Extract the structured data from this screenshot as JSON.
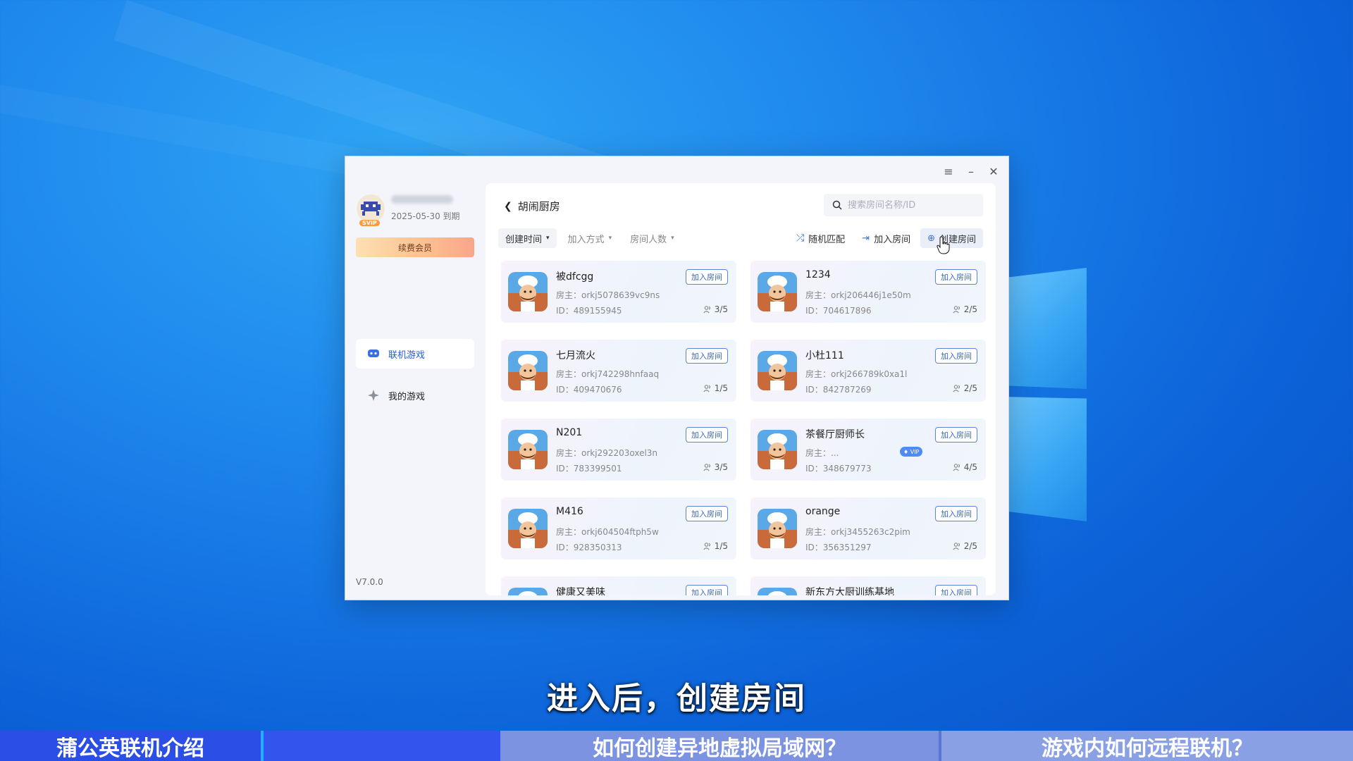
{
  "window": {
    "menu_icon": "hamburger-icon",
    "minimize_icon": "minimize-icon",
    "close_icon": "close-icon"
  },
  "sidebar": {
    "expiry": "2025-05-30 到期",
    "badge": "SVIP",
    "renew_label": "续费会员",
    "nav": [
      {
        "label": "联机游戏",
        "icon": "gamepad-icon",
        "active": true
      },
      {
        "label": "我的游戏",
        "icon": "sparkle-icon",
        "active": false
      }
    ],
    "version": "V7.0.0"
  },
  "header": {
    "title": "胡闹厨房",
    "search_placeholder": "搜索房间名称/ID"
  },
  "filters": [
    "创建时间",
    "加入方式",
    "房间人数"
  ],
  "actions": {
    "random": "随机匹配",
    "join": "加入房间",
    "create": "创建房间"
  },
  "rooms": [
    {
      "name": "被dfcgg",
      "host": "房主：orkj5078639vc9ns",
      "id": "ID：489155945",
      "count": "3/5",
      "join": "加入房间"
    },
    {
      "name": "1234",
      "host": "房主：orkj206446j1e50m",
      "id": "ID：704617896",
      "count": "2/5",
      "join": "加入房间"
    },
    {
      "name": "七月流火",
      "host": "房主：orkj742298hnfaaq",
      "id": "ID：409470676",
      "count": "1/5",
      "join": "加入房间"
    },
    {
      "name": "小杜111",
      "host": "房主：orkj266789k0xa1l",
      "id": "ID：842787269",
      "count": "2/5",
      "join": "加入房间"
    },
    {
      "name": "N201",
      "host": "房主：orkj292203oxel3n",
      "id": "ID：783399501",
      "count": "3/5",
      "join": "加入房间"
    },
    {
      "name": "茶餐厅厨师长",
      "host": "房主：...",
      "id": "ID：348679773",
      "count": "4/5",
      "join": "加入房间",
      "vip": "VIP"
    },
    {
      "name": "M416",
      "host": "房主：orkj604504ftph5w",
      "id": "ID：928350313",
      "count": "1/5",
      "join": "加入房间"
    },
    {
      "name": "orange",
      "host": "房主：orkj3455263c2pim",
      "id": "ID：356351297",
      "count": "2/5",
      "join": "加入房间"
    },
    {
      "name": "健康又美味",
      "host": "",
      "id": "",
      "count": "",
      "join": "加入房间"
    },
    {
      "name": "新东方大厨训练基地",
      "host": "",
      "id": "",
      "count": "",
      "join": "加入房间"
    }
  ],
  "subtitle": "进入后，创建房间",
  "bottom_bar": [
    {
      "label": "蒲公英联机介绍",
      "color": "#2a4ee6"
    },
    {
      "label": "",
      "color": "#3355ee"
    },
    {
      "label": "如何创建异地虚拟局域网？",
      "color": "#7b93e0"
    },
    {
      "label": "游戏内如何远程联机？",
      "color": "#8aa0e4"
    }
  ]
}
